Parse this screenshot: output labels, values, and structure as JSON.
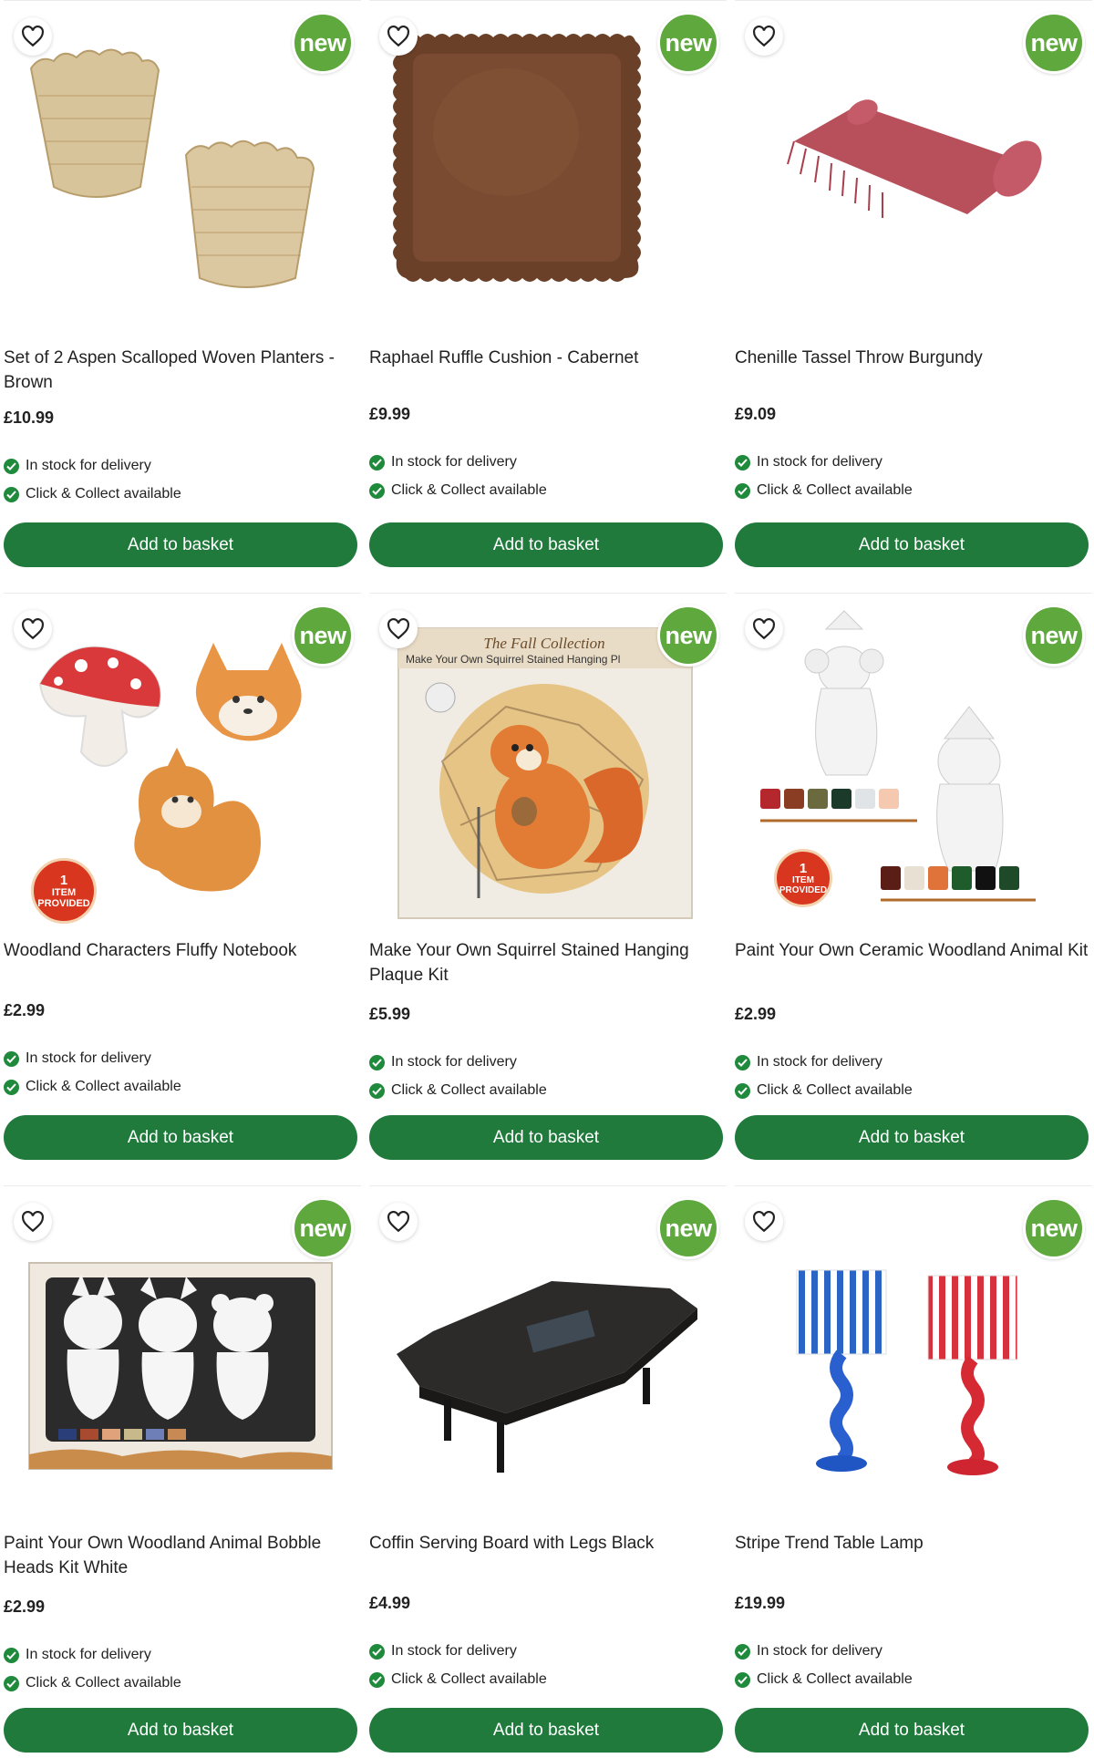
{
  "colors": {
    "brand_green": "#1f7a3c",
    "new_badge": "#5ea83e",
    "tick": "#1f8a3c",
    "item_badge": "#d8361e"
  },
  "icons": {
    "wishlist": "heart-outline-icon",
    "stock": "check-circle-icon"
  },
  "products": [
    {
      "title": "Set of 2 Aspen Scalloped Woven Planters - Brown",
      "price": "£10.99",
      "badge": "new",
      "stock_delivery": "In stock for delivery",
      "stock_collect": "Click & Collect available",
      "button": "Add to basket"
    },
    {
      "title": "Raphael Ruffle Cushion - Cabernet",
      "price": "£9.99",
      "badge": "new",
      "stock_delivery": "In stock for delivery",
      "stock_collect": "Click & Collect available",
      "button": "Add to basket"
    },
    {
      "title": "Chenille Tassel Throw Burgundy",
      "price": "£9.09",
      "badge": "new",
      "stock_delivery": "In stock for delivery",
      "stock_collect": "Click & Collect available",
      "button": "Add to basket"
    },
    {
      "title": "Woodland Characters Fluffy Notebook",
      "price": "£2.99",
      "badge": "new",
      "item_badge_num": "1",
      "item_badge_text": "ITEM PROVIDED",
      "stock_delivery": "In stock for delivery",
      "stock_collect": "Click & Collect available",
      "button": "Add to basket"
    },
    {
      "title": "Make Your Own Squirrel Stained Hanging Plaque Kit",
      "price": "£5.99",
      "badge": "new",
      "packaging_title": "The Fall Collection",
      "packaging_subtitle": "Make Your Own Squirrel Stained Hanging Pl",
      "stock_delivery": "In stock for delivery",
      "stock_collect": "Click & Collect available",
      "button": "Add to basket"
    },
    {
      "title": "Paint Your Own Ceramic Woodland Animal Kit",
      "price": "£2.99",
      "badge": "new",
      "item_badge_num": "1",
      "item_badge_text": "ITEM PROVIDED",
      "stock_delivery": "In stock for delivery",
      "stock_collect": "Click & Collect available",
      "button": "Add to basket"
    },
    {
      "title": "Paint Your Own Woodland Animal Bobble Heads Kit White",
      "price": "£2.99",
      "badge": "new",
      "stock_delivery": "In stock for delivery",
      "stock_collect": "Click & Collect available",
      "button": "Add to basket"
    },
    {
      "title": "Coffin Serving Board with Legs Black",
      "price": "£4.99",
      "badge": "new",
      "stock_delivery": "In stock for delivery",
      "stock_collect": "Click & Collect available",
      "button": "Add to basket"
    },
    {
      "title": "Stripe Trend Table Lamp",
      "price": "£19.99",
      "badge": "new",
      "stock_delivery": "In stock for delivery",
      "stock_collect": "Click & Collect available",
      "button": "Add to basket"
    }
  ]
}
